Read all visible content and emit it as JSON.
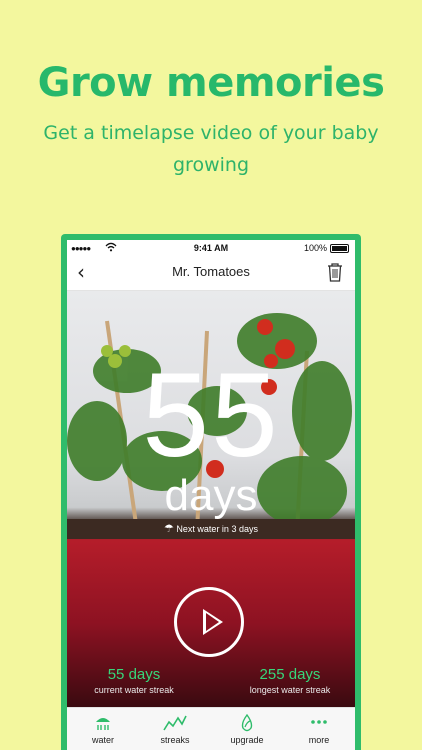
{
  "promo": {
    "headline": "Grow memories",
    "subtitle": "Get a timelapse video of your baby growing"
  },
  "status_bar": {
    "signal": "●●●●●",
    "time": "9:41 AM",
    "battery_pct": "100%"
  },
  "navbar": {
    "back_glyph": "‹",
    "title": "Mr. Tomatoes"
  },
  "hero": {
    "count": "55",
    "unit": "days",
    "next_water": "Next water in 3 days"
  },
  "streaks": {
    "current": {
      "value": "55 days",
      "label": "current water streak"
    },
    "longest": {
      "value": "255 days",
      "label": "longest water streak"
    }
  },
  "tabs": [
    {
      "label": "water",
      "icon": "watering-can-icon"
    },
    {
      "label": "streaks",
      "icon": "chart-line-icon"
    },
    {
      "label": "upgrade",
      "icon": "droplet-leaf-icon"
    },
    {
      "label": "more",
      "icon": "more-dots-icon"
    }
  ],
  "colors": {
    "background": "#f3f79e",
    "brand_green": "#2fbc6b",
    "streak_green": "#37d67a",
    "pot_red": "#b51d2a"
  }
}
